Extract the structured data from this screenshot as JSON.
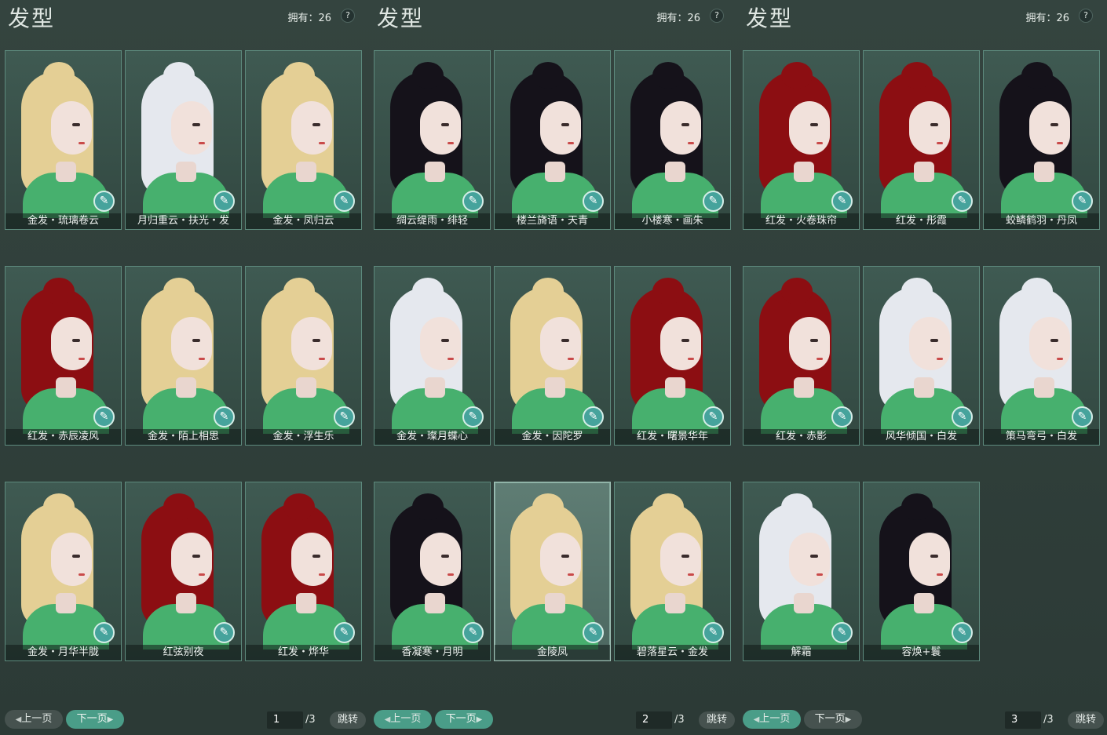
{
  "colors": {
    "blonde": "#e4cf95",
    "silver": "#e5e8ee",
    "black": "#15121a",
    "red": "#8c0e12",
    "accent": "#4a9d88"
  },
  "panels": [
    {
      "title": "发型",
      "owned": "拥有：26",
      "help": "?",
      "pager": {
        "prev": "上一页",
        "next": "下一页",
        "page": "1",
        "total": "/3",
        "jump": "跳转"
      },
      "items": [
        {
          "name": "金发・琉璃卷云",
          "hair": "blonde"
        },
        {
          "name": "月归重云・扶光・发",
          "hair": "silver"
        },
        {
          "name": "金发・凤归云",
          "hair": "blonde"
        },
        {
          "name": "红发・赤辰凌风",
          "hair": "red"
        },
        {
          "name": "金发・陌上相思",
          "hair": "blonde"
        },
        {
          "name": "金发・浮生乐",
          "hair": "blonde"
        },
        {
          "name": "金发・月华半胧",
          "hair": "blonde"
        },
        {
          "name": "红弦别夜",
          "hair": "red"
        },
        {
          "name": "红发・烨华",
          "hair": "red"
        }
      ]
    },
    {
      "title": "发型",
      "owned": "拥有：26",
      "help": "?",
      "pager": {
        "prev": "上一页",
        "next": "下一页",
        "page": "2",
        "total": "/3",
        "jump": "跳转"
      },
      "items": [
        {
          "name": "绸云缇雨・绯轻",
          "hair": "black"
        },
        {
          "name": "楼兰旖语・天青",
          "hair": "black"
        },
        {
          "name": "小楼寒・画朱",
          "hair": "black"
        },
        {
          "name": "金发・璨月蝶心",
          "hair": "silver"
        },
        {
          "name": "金发・因陀罗",
          "hair": "blonde"
        },
        {
          "name": "红发・曙景华年",
          "hair": "red"
        },
        {
          "name": "香凝寒・月明",
          "hair": "black"
        },
        {
          "name": "金陵凤",
          "hair": "blonde"
        },
        {
          "name": "碧落星云・金发",
          "hair": "blonde"
        }
      ]
    },
    {
      "title": "发型",
      "owned": "拥有：26",
      "help": "?",
      "pager": {
        "prev": "上一页",
        "next": "下一页",
        "page": "3",
        "total": "/3",
        "jump": "跳转"
      },
      "items": [
        {
          "name": "红发・火卷珠帘",
          "hair": "red"
        },
        {
          "name": "红发・彤霞",
          "hair": "red"
        },
        {
          "name": "蛟鳞鹤羽・丹凤",
          "hair": "black"
        },
        {
          "name": "红发・赤影",
          "hair": "red"
        },
        {
          "name": "风华倾国・白发",
          "hair": "silver"
        },
        {
          "name": "策马弯弓・白发",
          "hair": "silver"
        },
        {
          "name": "解霜",
          "hair": "silver"
        },
        {
          "name": "容焕+鬟",
          "hair": "black"
        }
      ]
    }
  ]
}
